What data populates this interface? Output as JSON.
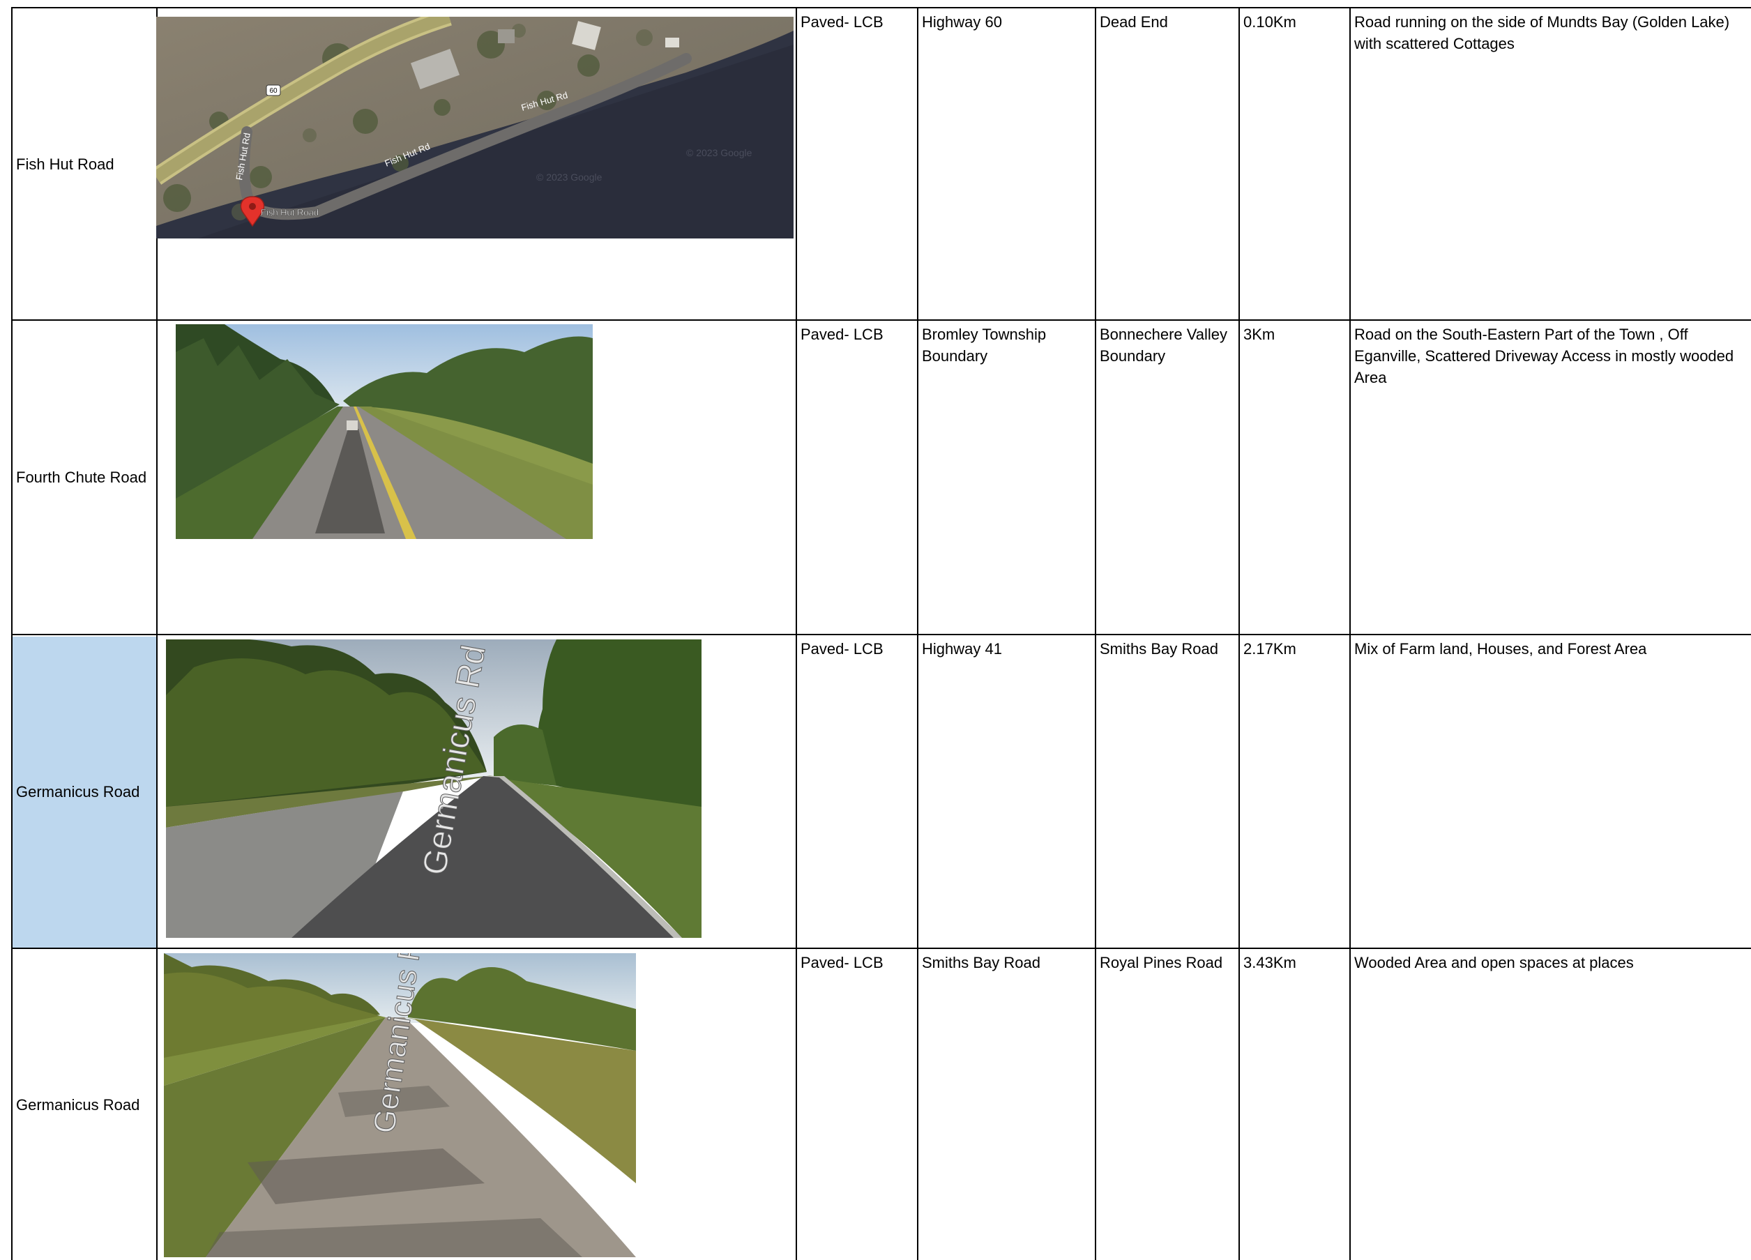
{
  "rows": [
    {
      "name": "Fish Hut Road",
      "surface": "Paved- LCB",
      "from": "Highway 60",
      "to": "Dead End",
      "length": "0.10Km",
      "description": "Road running on the side of Mundts Bay (Golden Lake) with scattered Cottages",
      "image": {
        "kind": "satellite-map",
        "highway_shield": "60",
        "street_labels": [
          "Fish Hut Rd",
          "Fish Hut Rd",
          "Fish Hut Rd"
        ],
        "pin_label": "Fish Hut Road",
        "watermarks": [
          "© 2023 Google",
          "© 2023 Google"
        ]
      }
    },
    {
      "name": "Fourth Chute Road",
      "surface": "Paved- LCB",
      "from": "Bromley Township Boundary",
      "to": "Bonnechere Valley Boundary",
      "length": "3Km",
      "description": "Road on the South-Eastern Part of the Town , Off Eganville, Scattered Driveway Access in mostly wooded Area",
      "image": {
        "kind": "street-view"
      }
    },
    {
      "name": "Germanicus Road",
      "surface": "Paved- LCB",
      "from": "Highway 41",
      "to": "Smiths Bay Road",
      "length": "2.17Km",
      "description": "Mix of Farm land, Houses, and Forest Area",
      "image": {
        "kind": "street-view",
        "road_label": "Germanicus Rd"
      },
      "highlight_color": "#bdd7ee"
    },
    {
      "name": "Germanicus Road",
      "surface": "Paved- LCB",
      "from": "Smiths Bay Road",
      "to": "Royal Pines Road",
      "length": "3.43Km",
      "description": "Wooded Area and open spaces at places",
      "image": {
        "kind": "street-view",
        "road_label": "Germanicus Rd"
      }
    }
  ]
}
